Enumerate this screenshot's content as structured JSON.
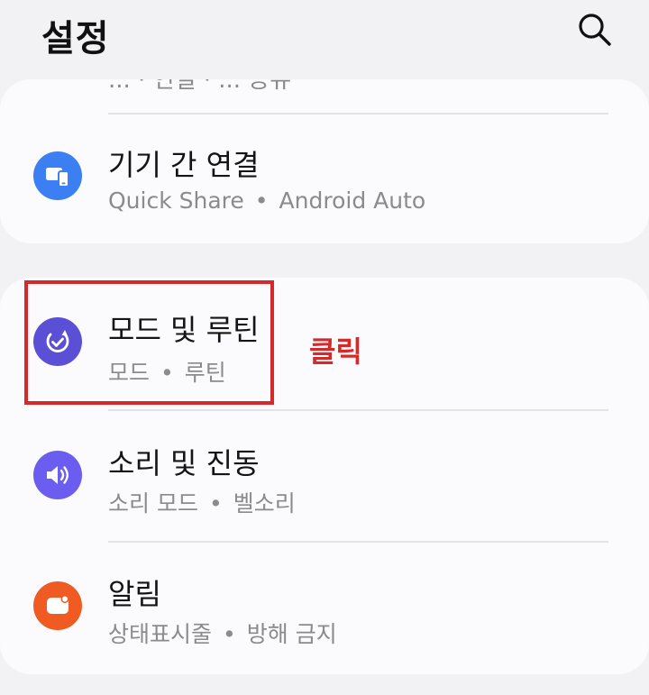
{
  "header": {
    "title": "설정",
    "search_icon": "search-icon"
  },
  "sections": {
    "card1": {
      "cut_off_text": "... · 연결 · ... 공유",
      "rows": [
        {
          "title": "기기 간 연결",
          "sub": [
            "Quick Share",
            "Android Auto"
          ],
          "icon": "device-connect-icon",
          "icon_color": "#3b7ff3"
        }
      ]
    },
    "card2": {
      "rows": [
        {
          "title": "모드 및 루틴",
          "sub": [
            "모드",
            "루틴"
          ],
          "icon": "modes-routines-icon",
          "icon_color": "#5b4fd6"
        },
        {
          "title": "소리 및 진동",
          "sub": [
            "소리 모드",
            "벨소리"
          ],
          "icon": "volume-icon",
          "icon_color": "#6a5df0"
        },
        {
          "title": "알림",
          "sub": [
            "상태표시줄",
            "방해 금지"
          ],
          "icon": "notification-icon",
          "icon_color": "#ef5b22"
        }
      ]
    }
  },
  "annotation": {
    "label": "클릭",
    "color": "#d42a2a"
  },
  "separator": "•"
}
